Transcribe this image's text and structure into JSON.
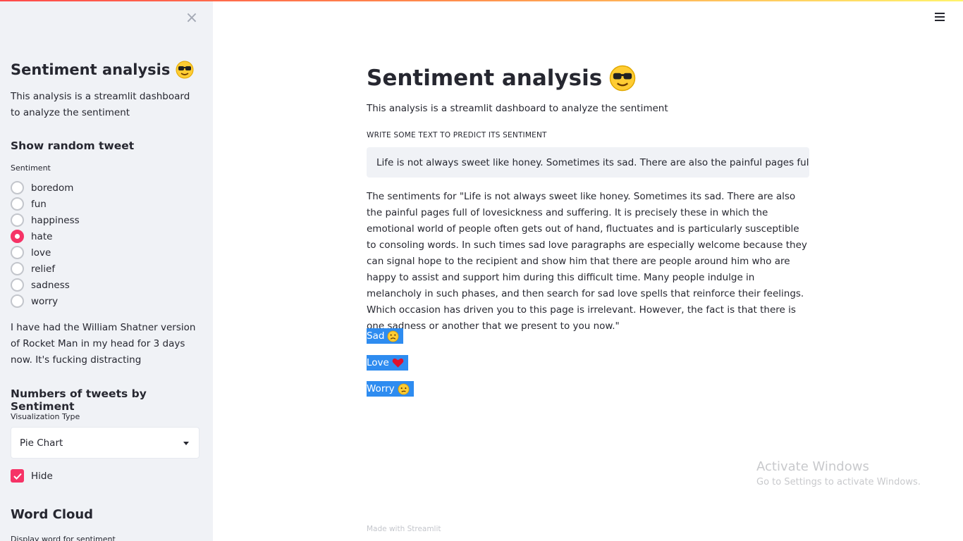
{
  "sidebar": {
    "close_glyph": "×",
    "title": "Sentiment analysis",
    "title_icon": "sunglasses-emoji",
    "description": "This analysis is a streamlit dashboard to analyze the sentiment",
    "random_tweet_heading": "Show random tweet",
    "sentiment_label": "Sentiment",
    "sentiment_options": [
      "boredom",
      "fun",
      "happiness",
      "hate",
      "love",
      "relief",
      "sadness",
      "worry"
    ],
    "selected_sentiment": "hate",
    "tweet_text": "I have had the William Shatner version of Rocket Man in my head for 3 days now. It's fucking distracting",
    "numbers_heading": "Numbers of tweets by Sentiment",
    "viz_label": "Visualization Type",
    "viz_value": "Pie Chart",
    "hide_label": "Hide",
    "hide_checked": true,
    "word_cloud_heading": "Word Cloud",
    "word_cloud_label": "Display word for sentiment"
  },
  "main": {
    "title": "Sentiment analysis",
    "title_icon": "sunglasses-emoji",
    "description": "This analysis is a streamlit dashboard to analyze the sentiment",
    "input_label": "WRITE SOME TEXT TO PREDICT ITS SENTIMENT",
    "input_value": "Life is not always sweet like honey. Sometimes its sad. There are also the painful pages full of",
    "result_text": "The sentiments for \"Life is not always sweet like honey. Sometimes its sad. There are also the painful pages full of lovesickness and suffering. It is precisely these in which the emotional world of people often gets out of hand, fluctuates and is particularly susceptible to consoling words. In such times sad love paragraphs are especially welcome because they can signal hope to the recipient and show him that there are people around him who are happy to assist and support him during this difficult time. Many people indulge in melancholy in such phases, and then search for sad love spells that reinforce their feelings. Which occasion has driven you to this page is irrelevant. However, the fact is that there is one sadness or another that we present to you now.\"",
    "tags": [
      {
        "label": "Sad",
        "icon": "sad-face-emoji"
      },
      {
        "label": "Love",
        "icon": "red-heart-emoji"
      },
      {
        "label": "Worry",
        "icon": "worried-face-emoji"
      }
    ],
    "footer": "Made with Streamlit"
  },
  "watermark": {
    "line1": "Activate Windows",
    "line2": "Go to Settings to activate Windows."
  },
  "colors": {
    "accent": "#f63366",
    "tag_bg": "#2e8cf0",
    "sidebar_bg": "#f0f2f6"
  }
}
